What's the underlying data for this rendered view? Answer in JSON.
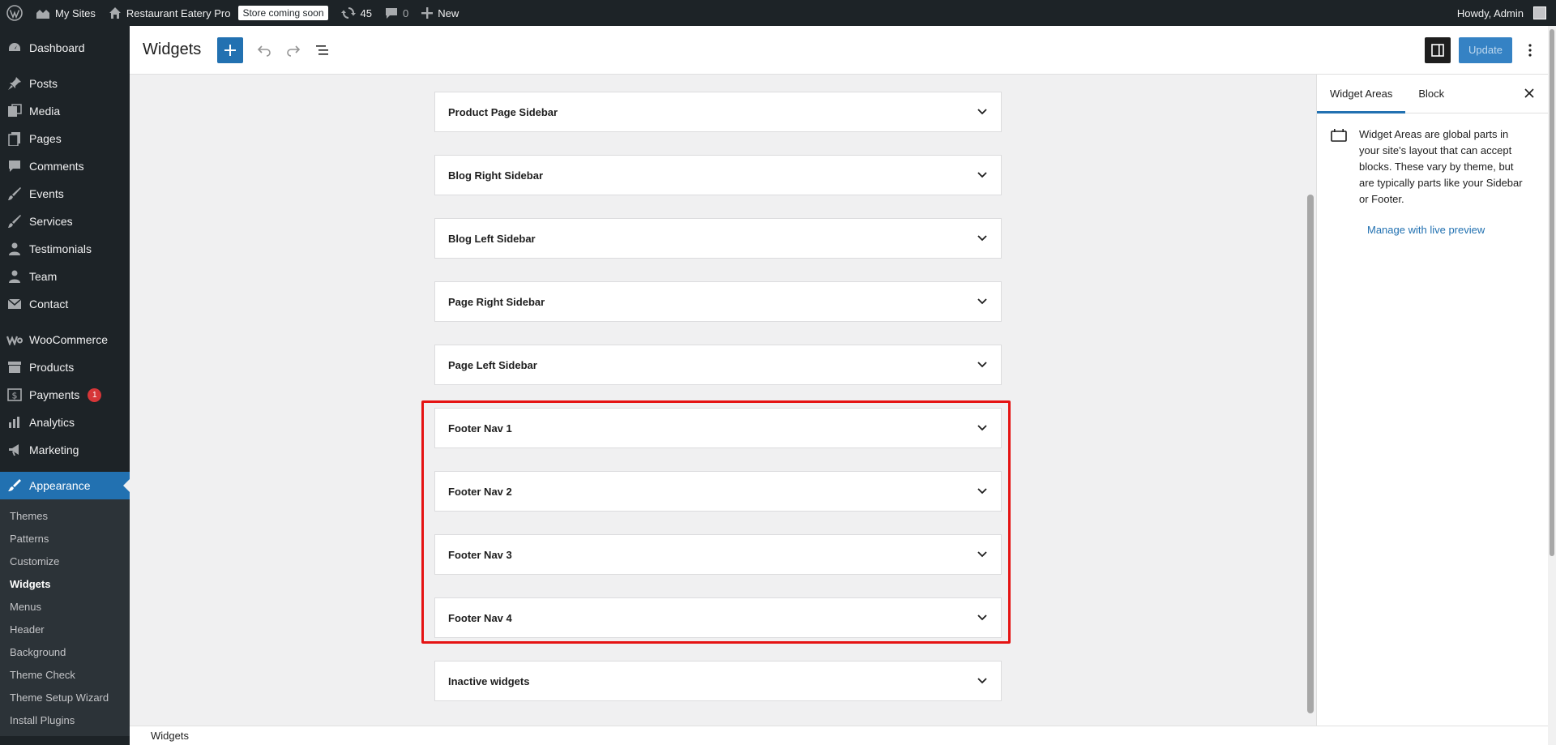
{
  "admin_bar": {
    "my_sites": "My Sites",
    "site_name": "Restaurant Eatery Pro",
    "store_badge": "Store coming soon",
    "updates_count": "45",
    "comments_count": "0",
    "new_label": "New",
    "howdy": "Howdy, Admin"
  },
  "sidebar": {
    "items": [
      {
        "label": "Dashboard"
      },
      {
        "label": "Posts"
      },
      {
        "label": "Media"
      },
      {
        "label": "Pages"
      },
      {
        "label": "Comments"
      },
      {
        "label": "Events"
      },
      {
        "label": "Services"
      },
      {
        "label": "Testimonials"
      },
      {
        "label": "Team"
      },
      {
        "label": "Contact"
      },
      {
        "label": "WooCommerce"
      },
      {
        "label": "Products"
      },
      {
        "label": "Payments",
        "badge": "1"
      },
      {
        "label": "Analytics"
      },
      {
        "label": "Marketing"
      },
      {
        "label": "Appearance"
      }
    ],
    "submenu": [
      {
        "label": "Themes"
      },
      {
        "label": "Patterns"
      },
      {
        "label": "Customize"
      },
      {
        "label": "Widgets"
      },
      {
        "label": "Menus"
      },
      {
        "label": "Header"
      },
      {
        "label": "Background"
      },
      {
        "label": "Theme Check"
      },
      {
        "label": "Theme Setup Wizard"
      },
      {
        "label": "Install Plugins"
      }
    ]
  },
  "header": {
    "title": "Widgets",
    "update_label": "Update"
  },
  "widget_areas": [
    {
      "title": "Product Page Sidebar"
    },
    {
      "title": "Blog Right Sidebar"
    },
    {
      "title": "Blog Left Sidebar"
    },
    {
      "title": "Page Right Sidebar"
    },
    {
      "title": "Page Left Sidebar"
    },
    {
      "title": "Footer Nav 1"
    },
    {
      "title": "Footer Nav 2"
    },
    {
      "title": "Footer Nav 3"
    },
    {
      "title": "Footer Nav 4"
    },
    {
      "title": "Inactive widgets"
    }
  ],
  "settings": {
    "tab_widget_areas": "Widget Areas",
    "tab_block": "Block",
    "description": "Widget Areas are global parts in your site's layout that can accept blocks. These vary by theme, but are typically parts like your Sidebar or Footer.",
    "live_preview_link": "Manage with live preview"
  },
  "footer": {
    "breadcrumb": "Widgets"
  },
  "colors": {
    "accent": "#2271b1",
    "highlight": "#e51313",
    "admin_dark": "#1d2327"
  }
}
